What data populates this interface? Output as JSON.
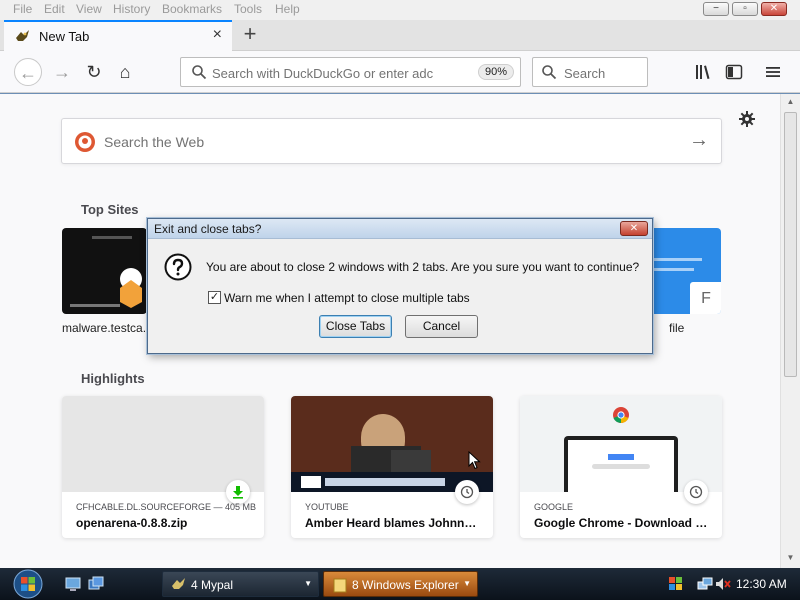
{
  "menubar": {
    "items": [
      "File",
      "Edit",
      "View",
      "History",
      "Bookmarks",
      "Tools",
      "Help"
    ],
    "minimize": "−",
    "maximize": "▫",
    "close": "✕"
  },
  "tabs": [
    {
      "title": "New Tab",
      "close": "×"
    }
  ],
  "newtab": "+",
  "navbar": {
    "back": "←",
    "forward": "→",
    "reload": "↻",
    "home": "⌂",
    "url_placeholder": "Search with DuckDuckGo or enter adc",
    "zoom": "90%",
    "search_placeholder": "Search"
  },
  "content": {
    "web_search_placeholder": "Search the Web",
    "web_search_arrow": "→",
    "top_sites_title": "Top Sites",
    "top_sites": [
      {
        "label": "malware.testca..."
      },
      {
        "label": "file"
      }
    ],
    "top_site_letter": "F",
    "highlights_title": "Highlights",
    "highlights": [
      {
        "source": "CFHCABLE.DL.SOURCEFORGE — 405 MB",
        "title": "openarena-0.8.8.zip",
        "badge": "download"
      },
      {
        "source": "YOUTUBE",
        "title": "Amber Heard blames Johnny ...",
        "badge": "clock"
      },
      {
        "source": "GOOGLE",
        "title": "Google Chrome - Download th...",
        "badge": "clock"
      }
    ]
  },
  "dialog": {
    "title": "Exit and close tabs?",
    "close": "✕",
    "message": "You are about to close 2 windows with 2 tabs. Are you sure you want to continue?",
    "checkbox_label": "Warn me when I attempt to close multiple tabs",
    "checkbox_mark": "✓",
    "confirm": "Close Tabs",
    "cancel": "Cancel"
  },
  "taskbar": {
    "buttons": [
      {
        "label": "4  Mypal"
      },
      {
        "label": "8  Windows Explorer"
      }
    ],
    "clock": "12:30 AM"
  },
  "colors": {
    "accent": "#0a84ff",
    "dialog_border": "#4d6a8c",
    "taskbar": "#0b121b"
  }
}
